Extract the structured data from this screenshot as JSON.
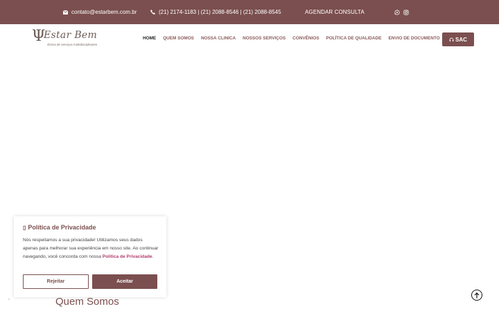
{
  "topbar": {
    "email": "contato@estarbem.com.br",
    "phone": "(21) 2174-1183 | (21) 2088-8546 | (21) 2088-8545",
    "cta": "AGENDAR CONSULTA",
    "icons": [
      "envelope-icon",
      "phone-icon",
      "whatsapp-icon",
      "instagram-icon"
    ]
  },
  "header": {
    "logo": {
      "mark": "Ψ",
      "name": "Estar Bem",
      "tagline": "clínica de serviços multidisciplinares"
    },
    "nav": [
      {
        "label": "HOME",
        "active": true
      },
      {
        "label": "QUEM SOMOS"
      },
      {
        "label": "NOSSA CLINICA"
      },
      {
        "label": "NOSSOS SERVIÇOS"
      },
      {
        "label": "CONVÊNIOS"
      },
      {
        "label": "POLÍTICA DE QUALIDADE"
      },
      {
        "label": "ENVIO DE DOCUMENTO"
      }
    ],
    "sac_label": "SAC"
  },
  "cookie": {
    "title": "Política de Privacidade",
    "body": "Nós respeitamos a sua privacidade! Utilizamos seus dados apenas para melhorar sua experiência em nosso site. Ao continuar navegando, você concorda com nossa ",
    "link": "Política de Privacidade",
    "end": ".",
    "reject": "Rejeitar",
    "accept": "Aceitar"
  },
  "section": {
    "title": "Quem Somos"
  },
  "colors": {
    "brand": "#7b4f4f",
    "link": "#b33b6d",
    "active_nav": "#222222"
  }
}
